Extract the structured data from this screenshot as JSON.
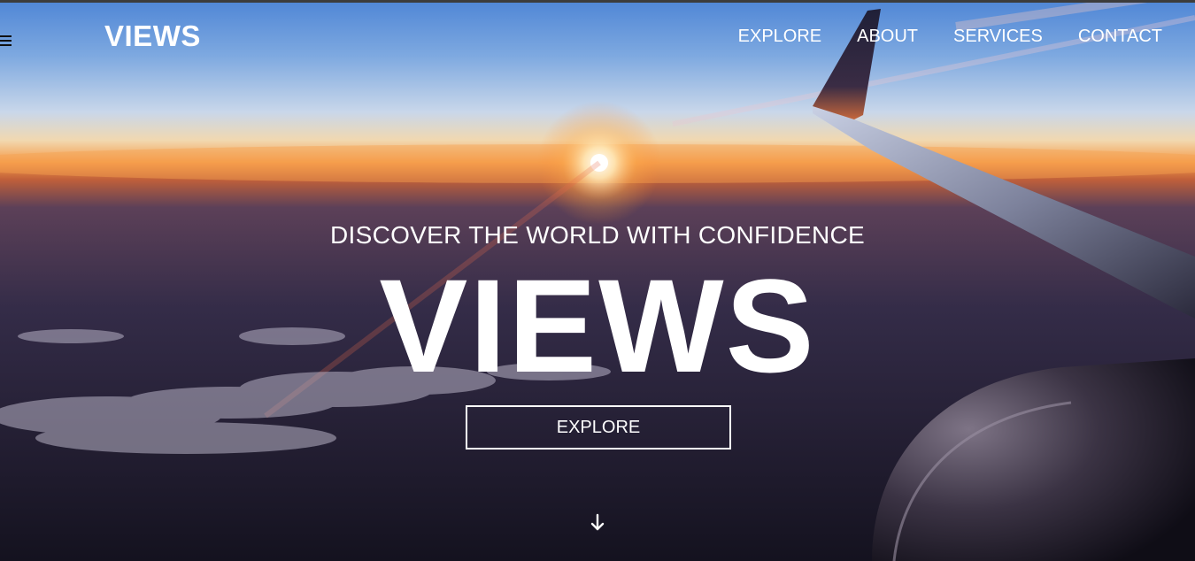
{
  "brand": {
    "logo_text": "VIEWS"
  },
  "nav": {
    "items": [
      "EXPLORE",
      "ABOUT",
      "SERVICES",
      "CONTACT"
    ]
  },
  "hero": {
    "tagline": "DISCOVER THE WORLD WITH CONFIDENCE",
    "headline": "VIEWS",
    "cta_label": "EXPLORE",
    "background": "sunset-above-clouds-with-airplane-wing"
  },
  "icons": {
    "menu": "hamburger-menu-icon",
    "scroll": "arrow-down-icon"
  },
  "colors": {
    "text": "#ffffff",
    "sky_top": "#5b8fd8",
    "horizon": "#f08a3c",
    "ground": "#1c1a2e"
  }
}
